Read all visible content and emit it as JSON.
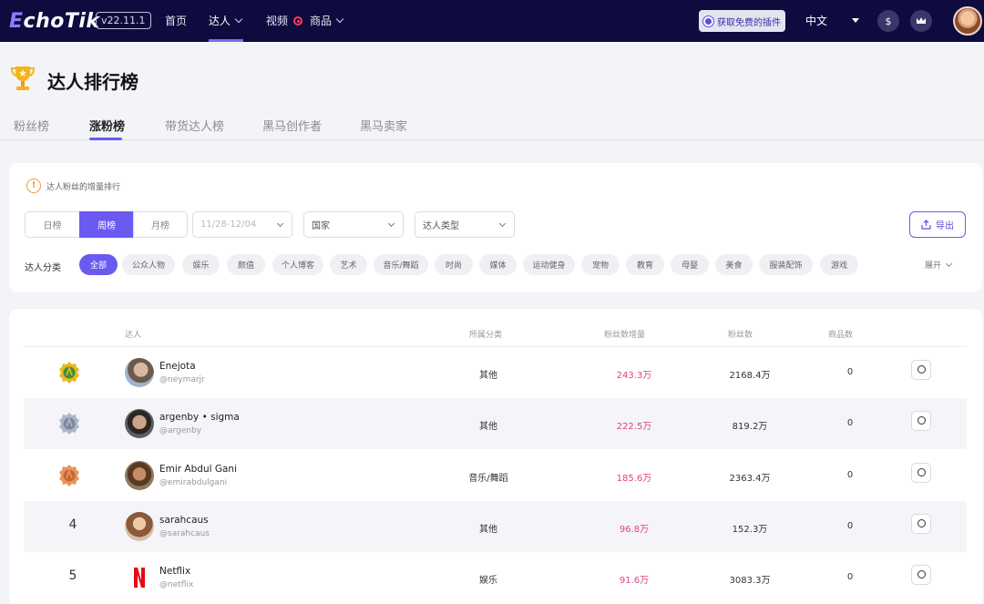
{
  "nav": {
    "logo_prefix": "E",
    "logo_rest": "choTik",
    "version": "v22.11.1",
    "items": [
      {
        "label": "首页"
      },
      {
        "label": "达人"
      },
      {
        "label": "视频"
      },
      {
        "label": "商品"
      }
    ],
    "plugin_button": "获取免费的插件",
    "language": "中文"
  },
  "page": {
    "title": "达人排行榜",
    "tabs": [
      "粉丝榜",
      "涨粉榜",
      "带货达人榜",
      "黑马创作者",
      "黑马卖家"
    ],
    "active_tab": "涨粉榜"
  },
  "filters": {
    "tip": "达人粉丝的增量排行",
    "periods": [
      "日榜",
      "周榜",
      "月榜"
    ],
    "active_period": "周榜",
    "date_range": "11/28-12/04",
    "country_placeholder": "国家",
    "type_placeholder": "达人类型",
    "export_label": "导出",
    "category_label": "达人分类",
    "categories": [
      "全部",
      "公众人物",
      "娱乐",
      "颜值",
      "个人博客",
      "艺术",
      "音乐/舞蹈",
      "时尚",
      "媒体",
      "运动健身",
      "宠物",
      "教育",
      "母婴",
      "美食",
      "服装配饰",
      "游戏"
    ],
    "active_category": "全部",
    "expand_label": "展开"
  },
  "table": {
    "headers": {
      "creator": "达人",
      "category": "所属分类",
      "growth": "粉丝数增量",
      "followers": "粉丝数",
      "products": "商品数"
    },
    "rows": [
      {
        "rank": "1",
        "name": "Enejota",
        "handle": "@neymarjr",
        "category": "其他",
        "growth": "243.3万",
        "followers": "2168.4万",
        "products": "0"
      },
      {
        "rank": "2",
        "name": "argenby • sigma",
        "handle": "@argenby",
        "category": "其他",
        "growth": "222.5万",
        "followers": "819.2万",
        "products": "0"
      },
      {
        "rank": "3",
        "name": "Emir Abdul Gani",
        "handle": "@emirabdulgani",
        "category": "音乐/舞蹈",
        "growth": "185.6万",
        "followers": "2363.4万",
        "products": "0"
      },
      {
        "rank": "4",
        "name": "sarahcaus",
        "handle": "@sarahcaus",
        "category": "其他",
        "growth": "96.8万",
        "followers": "152.3万",
        "products": "0"
      },
      {
        "rank": "5",
        "name": "Netflix",
        "handle": "@netflix",
        "category": "娱乐",
        "growth": "91.6万",
        "followers": "3083.3万",
        "products": "0"
      }
    ]
  },
  "colors": {
    "accent": "#6a5af0",
    "nav_bg": "#0e0b3f",
    "growth": "#e0408a"
  }
}
